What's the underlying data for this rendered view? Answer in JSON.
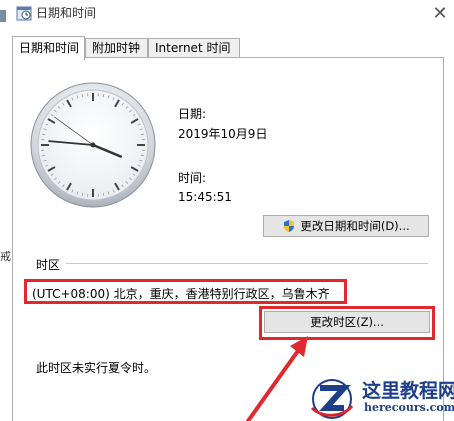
{
  "window": {
    "title": "日期和时间"
  },
  "tabs": [
    {
      "label": "日期和时间",
      "active": true
    },
    {
      "label": "附加时钟",
      "active": false
    },
    {
      "label": "Internet 时间",
      "active": false
    }
  ],
  "date": {
    "label": "日期:",
    "value": "2019年10月9日"
  },
  "time": {
    "label": "时间:",
    "value": "15:45:51"
  },
  "buttons": {
    "change_datetime": "更改日期和时间(D)...",
    "change_timezone": "更改时区(Z)..."
  },
  "timezone": {
    "group_label": "时区",
    "value": "(UTC+08:00) 北京，重庆，香港特别行政区，乌鲁木齐",
    "dst_note": "此时区未实行夏令时。"
  },
  "clock": {
    "hour": 15,
    "minute": 45,
    "second": 51
  },
  "side_fragment": "戒",
  "watermark": {
    "title": "这里教程网",
    "subtitle": "herecours.com"
  },
  "colors": {
    "highlight": "#e0282e",
    "logo_blue": "#1d3f8a"
  }
}
